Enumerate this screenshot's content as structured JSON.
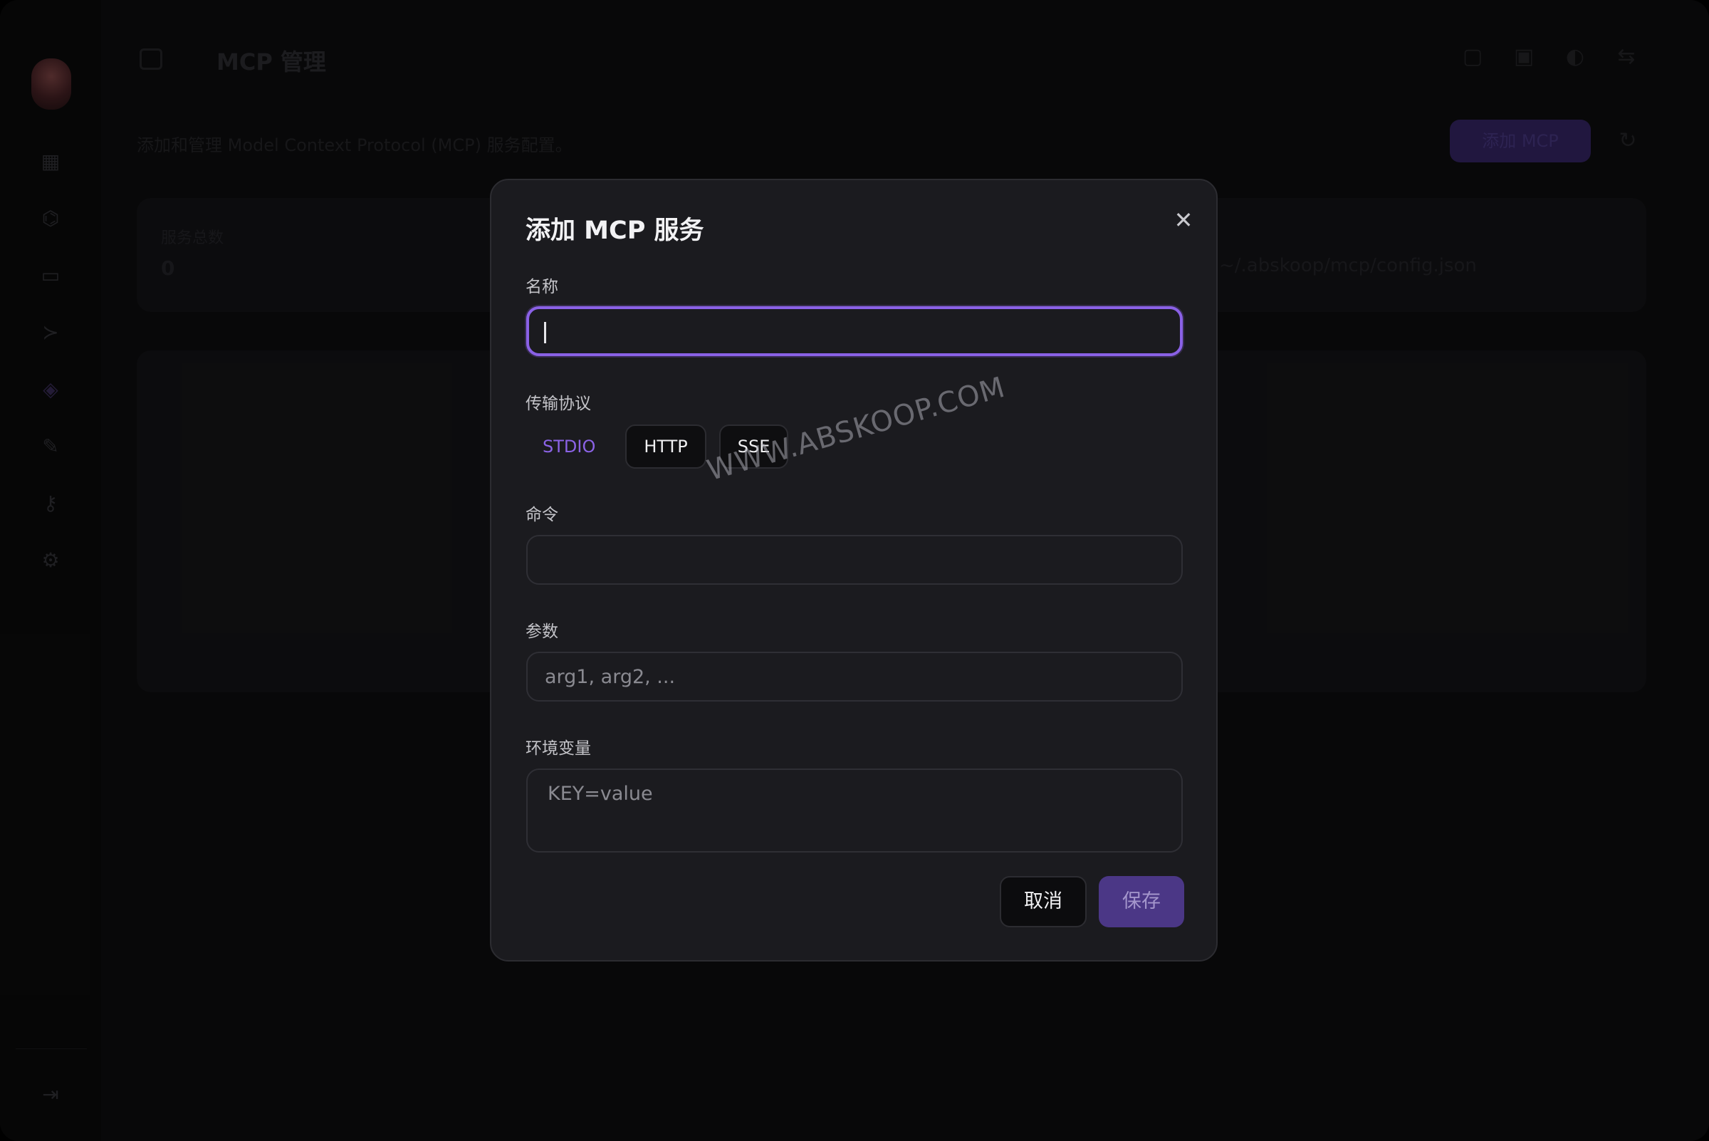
{
  "window": {
    "title": "MCP 管理",
    "subtitle": "添加和管理 Model Context Protocol (MCP) 服务配置。"
  },
  "background": {
    "add_button_label": "添加 MCP",
    "card_left_label": "服务总数",
    "card_left_value": "0",
    "card_right_value": "~/.abskoop/mcp/config.json"
  },
  "dialog": {
    "title": "添加 MCP 服务",
    "name_label": "名称",
    "name_value": "",
    "protocol_label": "传输协议",
    "protocols": [
      {
        "label": "STDIO",
        "selected": true
      },
      {
        "label": "HTTP",
        "selected": false
      },
      {
        "label": "SSE",
        "selected": false
      }
    ],
    "command_label": "命令",
    "command_value": "",
    "args_label": "参数",
    "args_placeholder": "arg1, arg2, ...",
    "env_label": "环境变量",
    "env_placeholder": "KEY=value",
    "cancel_label": "取消",
    "save_label": "保存"
  },
  "watermark": "WWW.ABSKOOP.COM",
  "colors": {
    "accent": "#8b63e6",
    "save_button": "#4b3786",
    "dialog_bg": "#1b1b1f"
  }
}
